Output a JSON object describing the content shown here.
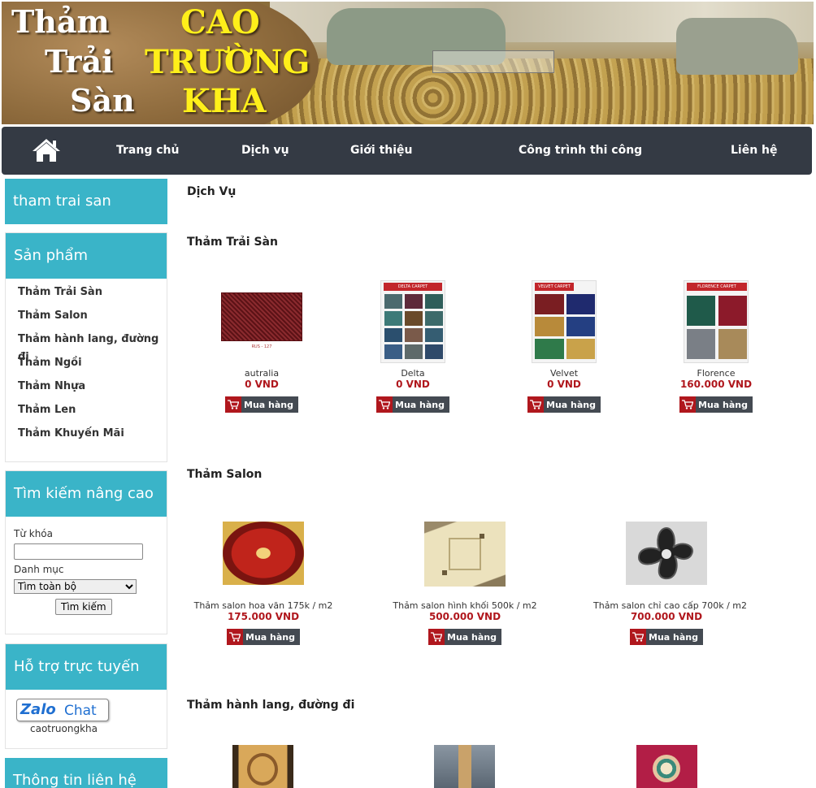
{
  "banner": {
    "left_lines": [
      "Thảm",
      "Trải",
      "Sàn"
    ],
    "right_lines": [
      "CAO",
      "TRƯỜNG",
      "KHA"
    ]
  },
  "nav": {
    "home_icon": "home-icon",
    "items": [
      "Trang chủ",
      "Dịch vụ",
      "Giới thiệu",
      "Công trình thi công",
      "Liên hệ"
    ]
  },
  "sidebar": {
    "site_box": {
      "title": "tham trai san"
    },
    "products": {
      "title": "Sản phẩm",
      "items": [
        "Thảm Trải Sàn",
        "Thảm Salon",
        "Thảm hành lang, đường đi",
        "Thảm Ngồi",
        "Thảm Nhựa",
        "Thảm Len",
        "Thảm Khuyến Mãi"
      ]
    },
    "search": {
      "title": "Tìm kiếm nâng cao",
      "keyword_label": "Từ khóa",
      "keyword_value": "",
      "category_label": "Danh mục",
      "category_selected": "Tìm toàn bộ",
      "button": "Tìm kiếm"
    },
    "support": {
      "title": "Hỗ trợ trực tuyến",
      "zalo_logo": "Zalo",
      "zalo_chat": "Chat",
      "zalo_user": "caotruongkha"
    },
    "contact": {
      "title": "Thông tin liên hệ"
    }
  },
  "main": {
    "page_title": "Dịch Vụ",
    "buy_label": "Mua hàng",
    "sections": [
      {
        "title": "Thảm Trải Sàn",
        "products": [
          {
            "name": "autralia",
            "price": "0 VND",
            "color": "#7e1f24",
            "img_caption": "RUS - 127"
          },
          {
            "name": "Delta",
            "price": "0 VND",
            "color": "#3d6a6a",
            "img_caption": "DELTA CARPET"
          },
          {
            "name": "Velvet",
            "price": "0 VND",
            "color": "#8c2a2a",
            "img_caption": "VELVET CARPET"
          },
          {
            "name": "Florence",
            "price": "160.000 VND",
            "color": "#2d5f4f",
            "img_caption": "FLORENCE CARPET"
          }
        ]
      },
      {
        "title": "Thảm Salon",
        "products": [
          {
            "name": "Thảm salon hoa văn 175k / m2",
            "price": "175.000 VND",
            "color": "#c0241b"
          },
          {
            "name": "Thảm salon hình khối 500k / m2",
            "price": "500.000 VND",
            "color": "#e6dcb4"
          },
          {
            "name": "Thảm salon chỉ cao cấp 700k / m2",
            "price": "700.000 VND",
            "color": "#d8d8d8"
          }
        ]
      },
      {
        "title": "Thảm hành lang, đường đi",
        "products": [
          {
            "color": "#b0702e"
          },
          {
            "color": "#6f7a86"
          },
          {
            "color": "#b21e46"
          }
        ]
      }
    ]
  }
}
